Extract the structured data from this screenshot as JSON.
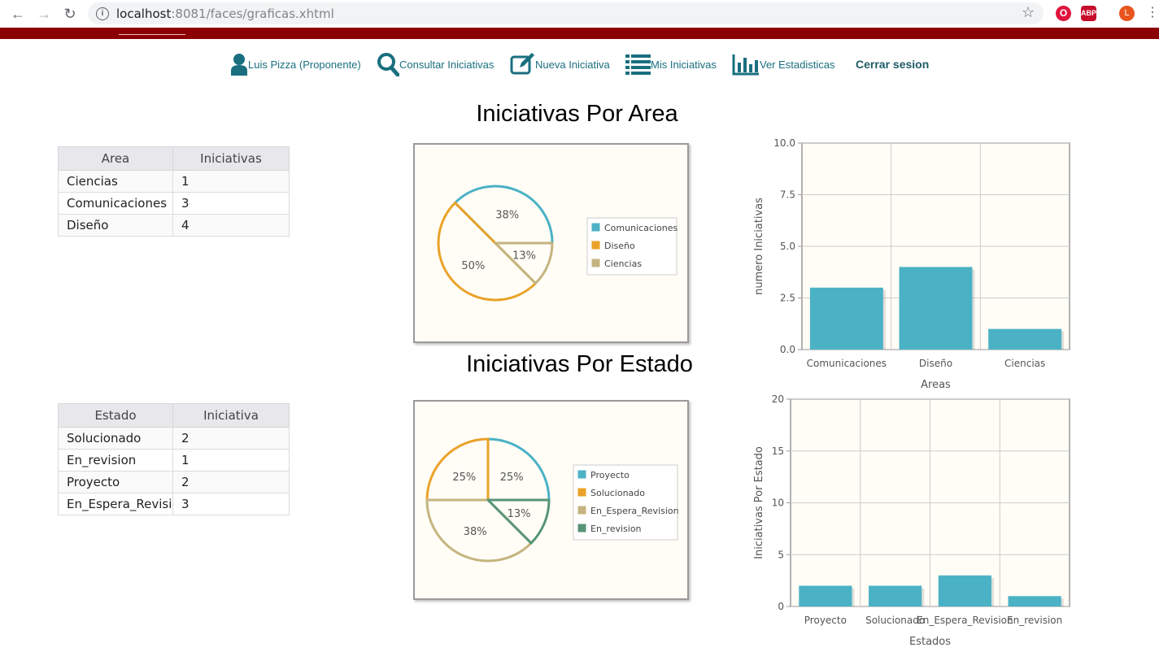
{
  "browser": {
    "url_host": "localhost",
    "url_rest": ":8081/faces/graficas.xhtml",
    "profile_initial": "L",
    "abp_label": "ABP"
  },
  "menu": {
    "user_label": "Luis Pizza (Proponente)",
    "consult_label": "Consultar Iniciativas",
    "new_label": "Nueva Iniciativa",
    "mine_label": "Mis Iniciativas",
    "stats_label": "Ver Estadisticas",
    "logout_label": "Cerrar sesion"
  },
  "area_section": {
    "title": "Iniciativas Por Area",
    "table": {
      "headers": [
        "Area",
        "Iniciativas"
      ],
      "rows": [
        [
          "Ciencias",
          "1"
        ],
        [
          "Comunicaciones",
          "3"
        ],
        [
          "Diseño",
          "4"
        ]
      ]
    }
  },
  "estado_section": {
    "title": "Iniciativas Por Estado",
    "table": {
      "headers": [
        "Estado",
        "Iniciativa"
      ],
      "rows": [
        [
          "Solucionado",
          "2"
        ],
        [
          "En_revision",
          "1"
        ],
        [
          "Proyecto",
          "2"
        ],
        [
          "En_Espera_Revisio",
          "3"
        ]
      ]
    }
  },
  "colors": {
    "teal": "#4bb2c5",
    "orange": "#eaa228",
    "tan": "#c5b47f",
    "green": "#579575",
    "brand_red": "#8b0000",
    "link": "#1a6f7f"
  },
  "chart_data": [
    {
      "type": "pie",
      "categories": [
        "Comunicaciones",
        "Diseño",
        "Ciencias"
      ],
      "values": [
        3,
        4,
        1
      ],
      "labels": [
        "38%",
        "50%",
        "13%"
      ],
      "colors": [
        "#4bb2c5",
        "#eaa228",
        "#c5b47f"
      ],
      "legend": "right"
    },
    {
      "type": "bar",
      "categories": [
        "Comunicaciones",
        "Diseño",
        "Ciencias"
      ],
      "values": [
        3,
        4,
        1
      ],
      "ylim": [
        0,
        10
      ],
      "yticks": [
        "0.0",
        "2.5",
        "5.0",
        "7.5",
        "10.0"
      ],
      "ylabel": "numero Iniciativas",
      "xlabel": "Areas",
      "grid": true
    },
    {
      "type": "pie",
      "categories": [
        "Proyecto",
        "Solucionado",
        "En_Espera_Revision",
        "En_revision"
      ],
      "values": [
        2,
        2,
        3,
        1
      ],
      "labels": [
        "25%",
        "25%",
        "38%",
        "13%"
      ],
      "colors": [
        "#4bb2c5",
        "#eaa228",
        "#c5b47f",
        "#579575"
      ],
      "legend": "right"
    },
    {
      "type": "bar",
      "categories": [
        "Proyecto",
        "Solucionado",
        "En_Espera_Revision",
        "En_revision"
      ],
      "values": [
        2,
        2,
        3,
        1
      ],
      "ylim": [
        0,
        20
      ],
      "yticks": [
        "0",
        "5",
        "10",
        "15",
        "20"
      ],
      "ylabel": "Iniciativas Por Estado",
      "xlabel": "Estados",
      "grid": true
    }
  ]
}
